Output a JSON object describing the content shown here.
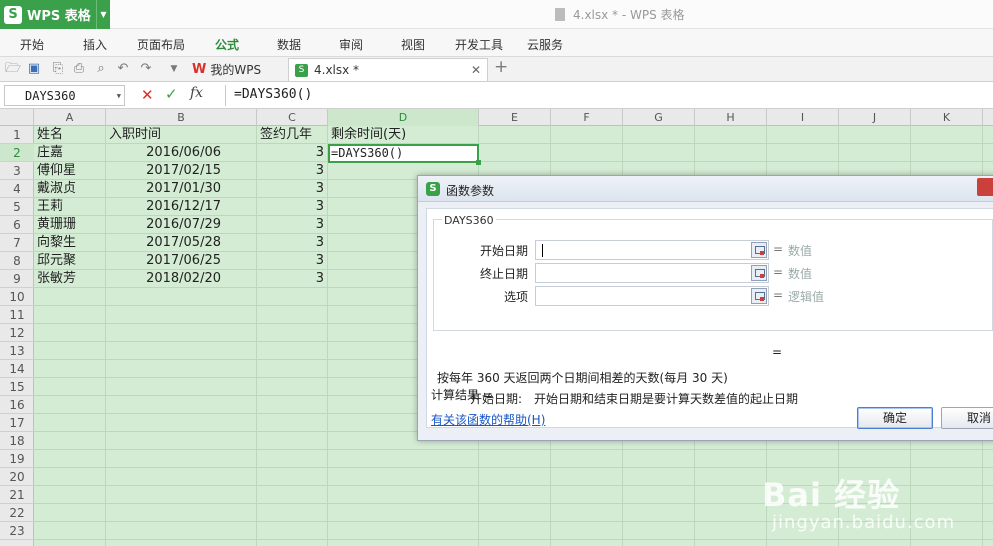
{
  "app": {
    "brand_logo": "S",
    "brand": "WPS 表格",
    "document_title": "4.xlsx * - WPS 表格"
  },
  "menu": [
    "开始",
    "插入",
    "页面布局",
    "公式",
    "数据",
    "审阅",
    "视图",
    "开发工具",
    "云服务"
  ],
  "menu_active": "公式",
  "doc_tabs": [
    {
      "icon": "wps-logo-icon",
      "label": "我的WPS"
    },
    {
      "icon": "xlsx-file-icon",
      "label": "4.xlsx *"
    }
  ],
  "formula_bar": {
    "name_box": "DAYS360",
    "cancel_icon": "✕",
    "accept_icon": "✓",
    "fx_label": "fx",
    "formula": "=DAYS360()"
  },
  "grid": {
    "columns": [
      "A",
      "B",
      "C",
      "D",
      "E",
      "F",
      "G",
      "H",
      "I",
      "J",
      "K"
    ],
    "selected_column": "D",
    "row_numbers": [
      "1",
      "2",
      "3",
      "4",
      "5",
      "6",
      "7",
      "8",
      "9",
      "10",
      "11",
      "12",
      "13",
      "14",
      "15",
      "16",
      "17",
      "18",
      "19",
      "20",
      "21",
      "22",
      "23"
    ],
    "selected_row": "2",
    "headers": [
      "姓名",
      "入职时间",
      "签约几年",
      "剩余时间(天)"
    ],
    "rows": [
      {
        "name": "庄嘉",
        "date": "2016/06/06",
        "years": "3"
      },
      {
        "name": "傅仰星",
        "date": "2017/02/15",
        "years": "3"
      },
      {
        "name": "戴淑贞",
        "date": "2017/01/30",
        "years": "3"
      },
      {
        "name": "王莉",
        "date": "2016/12/17",
        "years": "3"
      },
      {
        "name": "黄珊珊",
        "date": "2016/07/29",
        "years": "3"
      },
      {
        "name": "向黎生",
        "date": "2017/05/28",
        "years": "3"
      },
      {
        "name": "邱元聚",
        "date": "2017/06/25",
        "years": "3"
      },
      {
        "name": "张敏芳",
        "date": "2018/02/20",
        "years": "3"
      }
    ],
    "active_cell_value": "=DAYS360()"
  },
  "dialog": {
    "title_icon": "S",
    "title": "函数参数",
    "function_name": "DAYS360",
    "args": [
      {
        "label": "开始日期",
        "eq": "=",
        "hint": "数值"
      },
      {
        "label": "终止日期",
        "eq": "=",
        "hint": "数值"
      },
      {
        "label": "选项",
        "eq": "=",
        "hint": "逻辑值"
      }
    ],
    "result_eq": "=",
    "description": "按每年 360 天返回两个日期间相差的天数(每月 30 天)",
    "arg_desc_label": "开始日期:",
    "arg_desc_text": "开始日期和结束日期是要计算天数差值的起止日期",
    "calc_result": "计算结果 =",
    "help_link": "有关该函数的帮助(H)",
    "ok": "确定",
    "cancel": "取消"
  },
  "watermark": {
    "text": "Bai  经验",
    "url": "jingyan.baidu.com"
  }
}
